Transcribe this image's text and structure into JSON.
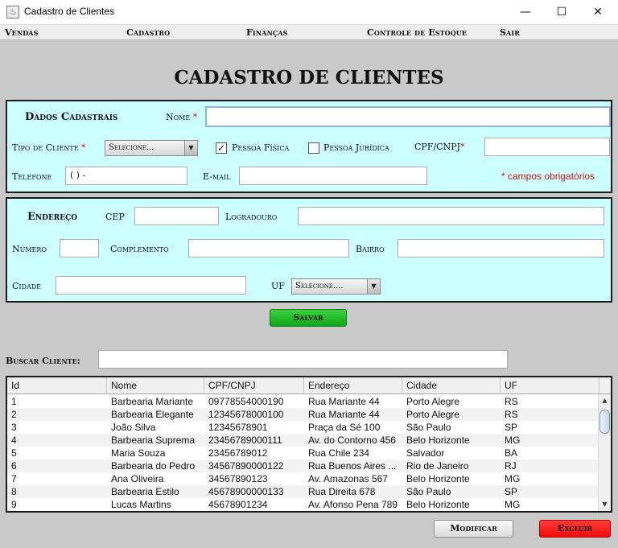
{
  "window": {
    "title": "Cadastro de Clientes",
    "app_icon": "java-cup-icon",
    "minimize_glyph": "—",
    "maximize_glyph": "☐",
    "close_glyph": "✕"
  },
  "menu": {
    "items": [
      "Vendas",
      "Cadastro",
      "Finanças",
      "Controle de Estoque",
      "Sair"
    ]
  },
  "page_title": "CADASTRO DE CLIENTES",
  "dados": {
    "section_title": "Dados Cadastrais",
    "nome_label": "Nome",
    "nome_value": "",
    "tipo_label": "Tipo de Cliente",
    "tipo_selected": "Selecione...",
    "pessoa_fisica_label": "Pessoa Física",
    "pessoa_fisica_checked": true,
    "pessoa_juridica_label": "Pessoa Jurídica",
    "pessoa_juridica_checked": false,
    "cpf_label": "CPF/CNPJ",
    "cpf_value": "",
    "telefone_label": "Telefone",
    "telefone_value": "( )    -",
    "email_label": "E-mail",
    "email_value": "",
    "required_marker": "*",
    "required_note": "* campos obrigatórios"
  },
  "endereco": {
    "section_title": "Endereço",
    "cep_label": "CEP",
    "logradouro_label": "Logradouro",
    "numero_label": "Número",
    "complemento_label": "Complemento",
    "bairro_label": "Bairro",
    "cidade_label": "Cidade",
    "uf_label": "UF",
    "uf_selected": "Selecione...."
  },
  "actions": {
    "salvar": "Salvar",
    "modificar": "Modificar",
    "excluir": "Excluir"
  },
  "search": {
    "label": "Buscar Cliente:",
    "value": ""
  },
  "table": {
    "columns": [
      "Id",
      "Nome",
      "CPF/CNPJ",
      "Endereço",
      "Cidade",
      "UF"
    ],
    "rows": [
      [
        "1",
        "Barbearia Mariante",
        "09778554000190",
        "Rua Mariante 44",
        "Porto Alegre",
        "RS"
      ],
      [
        "2",
        "Barbearia Elegante",
        "12345678000100",
        "Rua Mariante 44",
        "Porto Alegre",
        "RS"
      ],
      [
        "3",
        "João Silva",
        "12345678901",
        "Praça da Sé 100",
        "São Paulo",
        "SP"
      ],
      [
        "4",
        "Barbearia Suprema",
        "23456789000111",
        "Av. do Contorno 456",
        "Belo Horizonte",
        "MG"
      ],
      [
        "5",
        "Maria Souza",
        "23456789012",
        "Rua Chile 234",
        "Salvador",
        "BA"
      ],
      [
        "6",
        "Barbearia do Pedro",
        "34567890000122",
        "Rua Buenos Aires ...",
        "Rio de Janeiro",
        "RJ"
      ],
      [
        "7",
        "Ana Oliveira",
        "34567890123",
        "Av. Amazonas 567",
        "Belo Horizonte",
        "MG"
      ],
      [
        "8",
        "Barbearia Estilo",
        "45678900000133",
        "Rua Direita 678",
        "São Paulo",
        "SP"
      ],
      [
        "9",
        "Lucas Martins",
        "45678901234",
        "Av. Afonso Pena 789",
        "Belo Horizonte",
        "MG"
      ]
    ]
  },
  "colors": {
    "panel_bg": "#ccffff",
    "salvar_bg": "#22c22a",
    "excluir_bg": "#ff2020",
    "required": "#d01010"
  }
}
